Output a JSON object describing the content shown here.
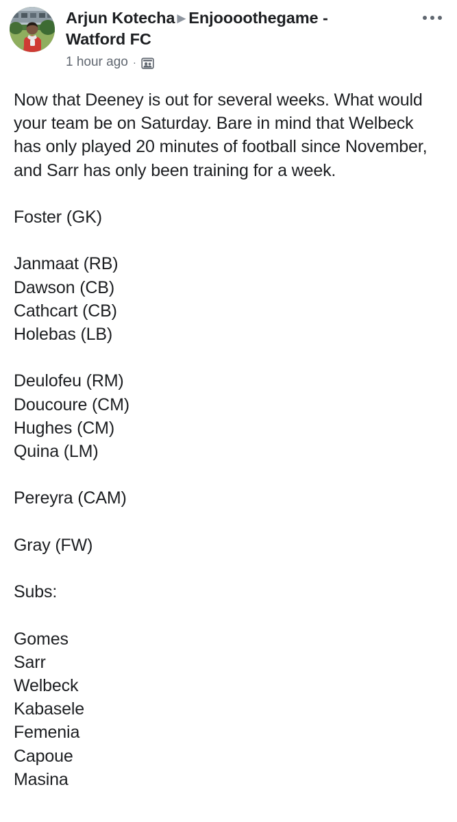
{
  "post": {
    "author": "Arjun Kotecha",
    "separator_icon": "triangle-right-icon",
    "group": "Enjoooothegame - Watford FC",
    "timestamp": "1 hour ago",
    "meta_dot": "·",
    "privacy_icon": "group-privacy-icon",
    "avatar_icon": "user-avatar-photo",
    "more_options_icon": "ellipsis-horizontal-icon",
    "more_options_label": "More options",
    "body": "Now that Deeney is out for several weeks. What would your team be on Saturday. Bare in mind that Welbeck has only played 20 minutes of football since November, and Sarr has only been training for a week.\n\nFoster (GK)\n\nJanmaat (RB)\nDawson (CB)\nCathcart (CB)\nHolebas (LB)\n\nDeulofeu (RM)\nDoucoure (CM)\nHughes (CM)\nQuina (LM)\n\nPereyra (CAM)\n\nGray (FW)\n\nSubs:\n\nGomes\nSarr\nWelbeck\nKabasele\nFemenia\nCapoue\nMasina",
    "body_sections": {
      "intro": "Now that Deeney is out for several weeks. What would your team be on Saturday. Bare in mind that Welbeck has only played 20 minutes of football since November, and Sarr has only been training for a week.",
      "goalkeeper": [
        "Foster (GK)"
      ],
      "defenders": [
        "Janmaat (RB)",
        "Dawson (CB)",
        "Cathcart (CB)",
        "Holebas (LB)"
      ],
      "midfielders": [
        "Deulofeu (RM)",
        "Doucoure (CM)",
        "Hughes (CM)",
        "Quina (LM)"
      ],
      "attacking_midfielder": [
        "Pereyra (CAM)"
      ],
      "forward": [
        "Gray (FW)"
      ],
      "subs_label": "Subs:",
      "subs": [
        "Gomes",
        "Sarr",
        "Welbeck",
        "Kabasele",
        "Femenia",
        "Capoue",
        "Masina"
      ]
    }
  },
  "colors": {
    "background": "#ffffff",
    "primary_text": "#1c1e21",
    "secondary_text": "#606770",
    "separator": "#8d949e"
  }
}
